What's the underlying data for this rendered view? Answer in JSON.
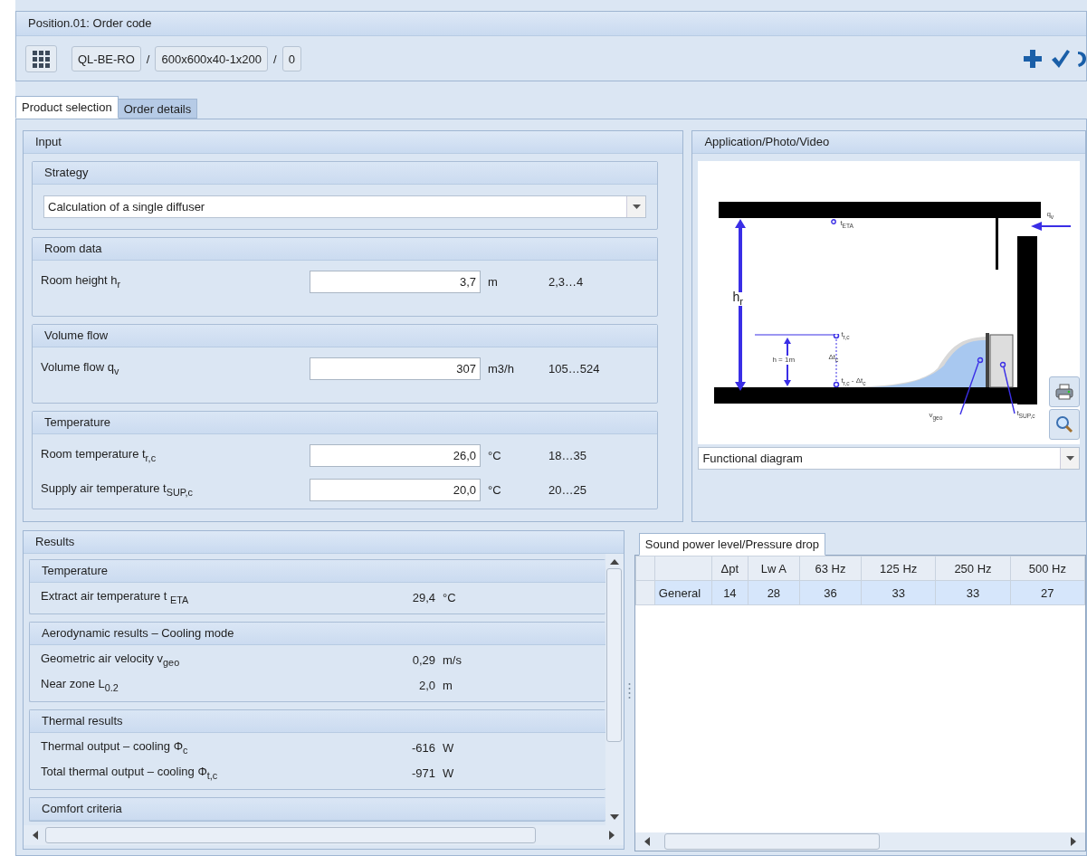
{
  "header": {
    "title": "Position.01: Order code",
    "code_parts": [
      "QL-BE-RO",
      "600x600x40-1x200",
      "0"
    ],
    "separators": [
      "/",
      "/"
    ]
  },
  "tabs": [
    {
      "label": "Product selection",
      "selected": true
    },
    {
      "label": "Order details",
      "selected": false
    }
  ],
  "input": {
    "title": "Input",
    "groups": [
      {
        "kind": "select",
        "title": "Strategy",
        "value": "Calculation of a single diffuser"
      },
      {
        "kind": "fields",
        "title": "Room data",
        "rows": [
          {
            "label": "Room height h$_{r}$",
            "value": "3,7",
            "unit": "m",
            "range": "2,3…4"
          }
        ]
      },
      {
        "kind": "fields",
        "title": "Volume flow",
        "rows": [
          {
            "label": "Volume flow q$_{v}$",
            "value": "307",
            "unit": "m3/h",
            "range": "105…524"
          }
        ]
      },
      {
        "kind": "fields",
        "title": "Temperature",
        "rows": [
          {
            "label": "Room temperature t$_{r,c}$",
            "value": "26,0",
            "unit": "°C",
            "range": "18…35"
          },
          {
            "label": "Supply air temperature t$_{SUP,c}$",
            "value": "20,0",
            "unit": "°C",
            "range": "20…25"
          }
        ]
      }
    ]
  },
  "media": {
    "title": "Application/Photo/Video",
    "diagram_labels": [
      "t$_{ETA}$",
      "q$_{v}$",
      "h$_{r}$",
      "t$_{r,c}$",
      "h = 1m",
      "Δt$_{c}$",
      "t$_{r,c}$ - Δt$_{c}$",
      "v$_{geo}$",
      "t$_{SUP,c}$"
    ],
    "view": "Functional diagram"
  },
  "results": {
    "title": "Results",
    "groups": [
      {
        "title": "Temperature",
        "rows": [
          {
            "label": "Extract air temperature t $_{ETA}$",
            "value": "29,4",
            "unit": "°C"
          }
        ]
      },
      {
        "title": "Aerodynamic results – Cooling mode",
        "rows": [
          {
            "label": "Geometric air velocity v$_{geo}$",
            "value": "0,29",
            "unit": "m/s"
          },
          {
            "label": "Near zone L$_{0.2}$",
            "value": "2,0",
            "unit": "m"
          }
        ]
      },
      {
        "title": "Thermal results",
        "rows": [
          {
            "label": "Thermal output – cooling Φ$_{c}$",
            "value": "-616",
            "unit": "W"
          },
          {
            "label": "Total thermal output – cooling Φ$_{t,c}$",
            "value": "-971",
            "unit": "W"
          }
        ]
      },
      {
        "title": "Comfort criteria"
      }
    ]
  },
  "sound": {
    "tab": "Sound power level/Pressure drop",
    "columns": [
      "Δpt",
      "Lw A",
      "63 Hz",
      "125 Hz",
      "250 Hz",
      "500 Hz"
    ],
    "rows": [
      {
        "name": "General",
        "values": [
          "14",
          "28",
          "36",
          "33",
          "33",
          "27"
        ],
        "selected": true
      }
    ]
  }
}
